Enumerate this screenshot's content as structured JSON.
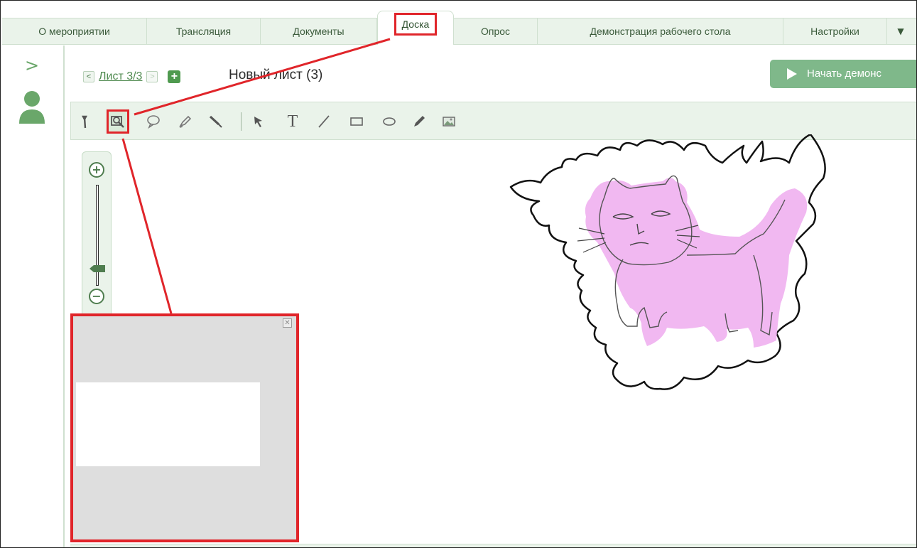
{
  "tabs": [
    {
      "label": "О мероприятии"
    },
    {
      "label": "Трансляция"
    },
    {
      "label": "Документы"
    },
    {
      "label": "Доска"
    },
    {
      "label": "Опрос"
    },
    {
      "label": "Демонстрация рабочего стола"
    },
    {
      "label": "Настройки"
    }
  ],
  "tabs_more_icon": "caret-down-icon",
  "active_tab": "Доска",
  "sheet": {
    "prev_icon": "chevron-left-icon",
    "link": "Лист 3/3",
    "next_icon": "chevron-right-icon",
    "add_icon": "plus-icon",
    "title": "Новый лист (3)"
  },
  "header": {
    "start_demo_label": "Начать демонс"
  },
  "toolbar": {
    "tools": [
      "undo-arrow-icon",
      "zoom-view-icon",
      "comment-bubble-icon",
      "highlighter-icon",
      "pen-brush-icon",
      "select-arrow-icon",
      "text-tool-icon",
      "line-tool-icon",
      "rectangle-tool-icon",
      "ellipse-tool-icon",
      "pencil-icon",
      "image-icon"
    ],
    "text_tool_glyph": "T",
    "selected_tool": "zoom-view-icon"
  },
  "zoom": {
    "plus": "+",
    "minus": "−",
    "level": 0.17
  },
  "preview": {
    "close_glyph": "✕"
  },
  "colors": {
    "accent_green": "#7fb88a",
    "tab_bg": "#eaf3ea",
    "highlight_red": "#e0252a",
    "cat_fill": "#f0b0f0"
  }
}
